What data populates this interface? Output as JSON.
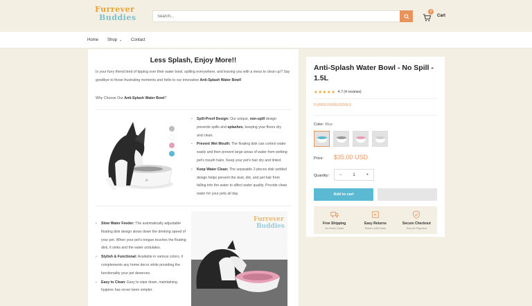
{
  "header": {
    "logo_line1": "Furrever",
    "logo_line2": "Buddies",
    "search_placeholder": "Search...",
    "cart_label": "Cart",
    "cart_count": "0"
  },
  "nav": {
    "items": [
      {
        "label": "Home"
      },
      {
        "label": "Shop"
      },
      {
        "label": "Contact"
      }
    ]
  },
  "content": {
    "title": "Less Splash, Enjoy More!!",
    "intro_pre": "Is your furry friend tired of tipping over their water bowl, spilling everywhere, and leaving you with a mess to clean up? Say goodbye to those frustrating moments and hello to our innovative ",
    "intro_bold": "Anti-Splash Water Bowl!",
    "why_pre": "Why Choose Our ",
    "why_bold": "Anti-Splash Water Bowl",
    "why_post": "?",
    "features_a": [
      {
        "title": "Spill-Proof Design:",
        "t1": " Our unique, ",
        "b1": "non-spill",
        "t2": " design prevents spills and ",
        "b2": "splashes",
        "t3": ", keeping your floors dry and clean."
      },
      {
        "title": "Prevent Wet Mouth:",
        "text": " The floating disk can control water easily and then prevent large areas of water from wetting pet's mouth hairs. Keep your pet's hair dry and tinted."
      },
      {
        "title": "Keep Water Clean:",
        "text": " The separable 2-pieces disk welded design helps prevent the dust, dirt, and pet hair from falling into the water to affect water quality. Provide clean water for your pets all day."
      }
    ],
    "features_b": [
      {
        "title": "Slow Water Feeder:",
        "text": " The automatically adjustable floating disk design slows down the drinking speed of your pet. When your pet's tongue touches the floating disk, it sinks and the water undulates."
      },
      {
        "title": "Stylish & Functional:",
        "text": " Available in various colors, it complements any home decor while providing the functionality your pet deserves."
      },
      {
        "title": "Easy to Clean:",
        "text": " Easy to wipe down, maintaining hygiene has never been simpler."
      }
    ]
  },
  "product": {
    "title": "Anti-Splash Water Bowl - No Spill - 1.5L",
    "rating": 4.7,
    "rating_text": "4.7 (4 reviews)",
    "vendor": "FURREVERBUDDIES",
    "color_label": "Color:",
    "color_value": "Blue",
    "swatch_colors": [
      "#5bb9d4",
      "#bdbdbd",
      "#e79fb8",
      "#d9d9d9"
    ],
    "price_label": "Price:",
    "price": "$35.00 USD",
    "qty_label": "Quantity:",
    "qty_minus": "−",
    "qty_value": "1",
    "qty_plus": "+",
    "add_to_cart": "Add to cart"
  },
  "perks": [
    {
      "title": "Free Shipping",
      "sub": "No Extra Costs",
      "icon": "truck-icon"
    },
    {
      "title": "Easy Returns",
      "sub": "Return with Ease",
      "icon": "return-box-icon"
    },
    {
      "title": "Secure Checkout",
      "sub": "Secure Payment",
      "icon": "shield-check-icon"
    }
  ],
  "colors": {
    "accent": "#e8935a",
    "button": "#5bb9d4",
    "background": "#f4efe3"
  }
}
